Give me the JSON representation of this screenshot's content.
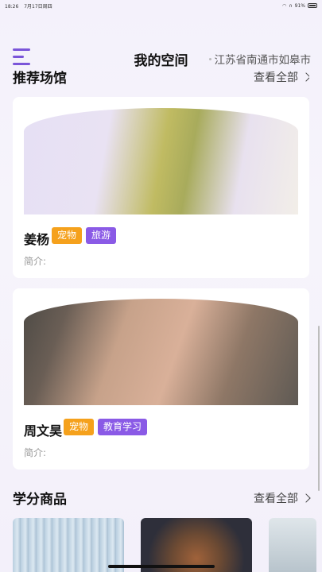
{
  "status": {
    "time": "18:26",
    "date": "7月17日周四",
    "battery": "91%"
  },
  "header": {
    "title": "我的空间",
    "location": "江苏省南通市如皋市"
  },
  "recommended": {
    "title": "推荐场馆",
    "see_all": "查看全部",
    "items": [
      {
        "name": "姜杨",
        "tags": [
          "宠物",
          "旅游"
        ],
        "intro": "简介:"
      },
      {
        "name": "周文昊",
        "tags": [
          "宠物",
          "教育学习"
        ],
        "intro": "简介:"
      }
    ]
  },
  "products": {
    "title": "学分商品",
    "see_all": "查看全部"
  },
  "colors": {
    "accent": "#7a55d9",
    "tag_orange": "#f5a11c",
    "tag_purple": "#8a5ae6"
  }
}
